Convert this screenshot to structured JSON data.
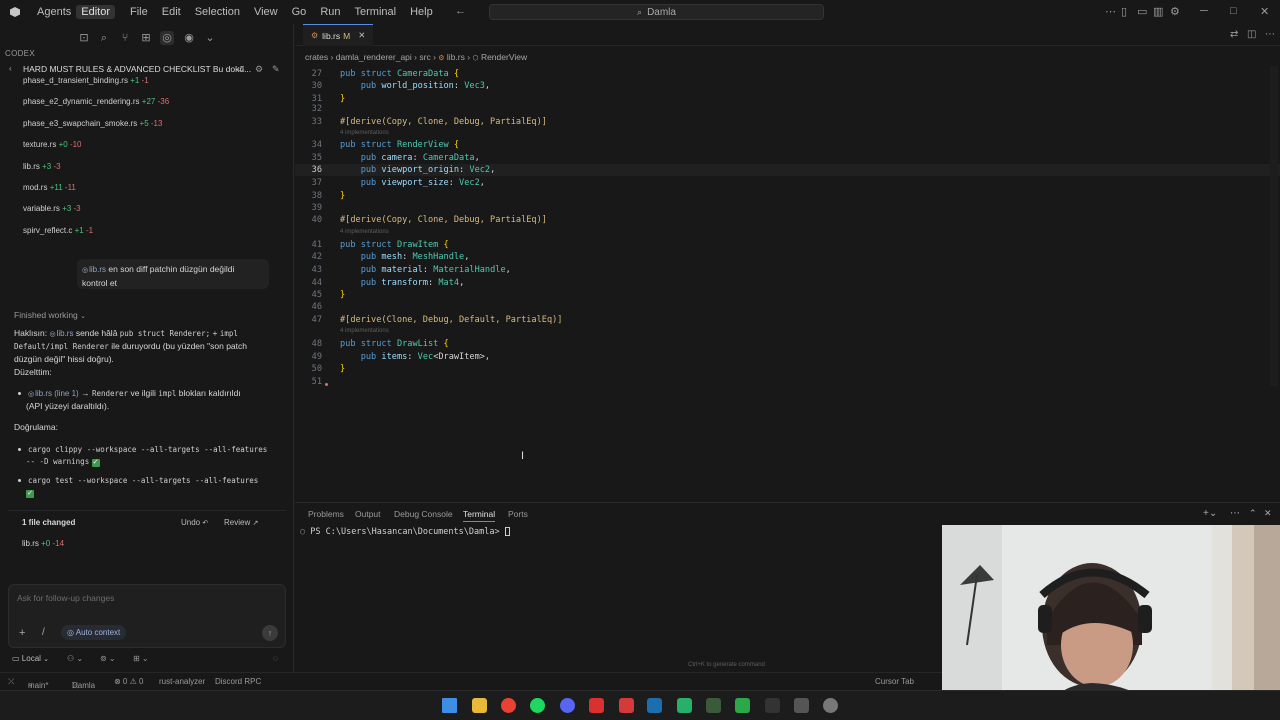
{
  "titlebar": {
    "modes": [
      "Agents",
      "Editor"
    ],
    "active_mode": "Editor",
    "menu": [
      "File",
      "Edit",
      "Selection",
      "View",
      "Go",
      "Run",
      "Terminal",
      "Help"
    ],
    "search_text": "Damla"
  },
  "codex": {
    "section_label": "CODEX",
    "chat_title": "HARD MUST RULES & ADVANCED CHECKLIST Bu dokü...",
    "changed_files": [
      {
        "name": "phase_d_transient_binding.rs",
        "plus": "+1",
        "minus": "-1"
      },
      {
        "name": "phase_e2_dynamic_rendering.rs",
        "plus": "+27",
        "minus": "-36"
      },
      {
        "name": "phase_e3_swapchain_smoke.rs",
        "plus": "+5",
        "minus": "-13"
      },
      {
        "name": "texture.rs",
        "plus": "+0",
        "minus": "-10"
      },
      {
        "name": "lib.rs",
        "plus": "+3",
        "minus": "-3"
      },
      {
        "name": "mod.rs",
        "plus": "+11",
        "minus": "-11"
      },
      {
        "name": "variable.rs",
        "plus": "+3",
        "minus": "-3"
      },
      {
        "name": "spirv_reflect.c",
        "plus": "+1",
        "minus": "-1"
      }
    ],
    "user_message": {
      "chip": "lib.rs",
      "line1": "en son diff patchin düzgün değildi",
      "line2": "kontrol et"
    },
    "status": "Finished working",
    "response": {
      "p1_a": "Haklısın:",
      "p1_chip": "lib.rs",
      "p1_b": "sende hâlâ",
      "p1_code1": "pub struct Renderer;",
      "p1_c": "+",
      "p1_code2": "impl",
      "p2_code": "Default/impl Renderer",
      "p2_text": "ile duruyordu (bu yüzden \"son patch",
      "p3": "düzgün değil\" hissi doğru).",
      "fixed_label": "Düzelttim:",
      "bullet1_chip": "lib.rs (line 1)",
      "bullet1_arrow": "→",
      "bullet1_code": "Renderer",
      "bullet1_text": "ve ilgili",
      "bullet1_code2": "impl",
      "bullet1_text2": "blokları kaldırıldı",
      "bullet1_line2": "(API yüzeyi daraltıldı).",
      "verify_label": "Doğrulama:",
      "cmd1_line1": "cargo clippy --workspace --all-targets --all-features",
      "cmd1_line2": "-- -D warnings",
      "cmd2": "cargo test --workspace --all-targets --all-features"
    },
    "summary": {
      "files_changed": "1 file changed",
      "undo": "Undo",
      "review": "Review",
      "file": "lib.rs",
      "plus": "+0",
      "minus": "-14"
    },
    "followup_placeholder": "Ask for follow-up changes",
    "auto_context": "Auto context",
    "local": "Local"
  },
  "editor": {
    "tab_name": "lib.rs",
    "tab_status": "M",
    "breadcrumb": [
      "crates",
      "damla_renderer_api",
      "src",
      "lib.rs",
      "RenderView"
    ],
    "hint": "4 implementations",
    "lines": [
      {
        "n": "27",
        "text": "pub struct CameraData {"
      },
      {
        "n": "30",
        "text": "    pub world_position: Vec3,"
      },
      {
        "n": "31",
        "text": "}"
      },
      {
        "n": "32",
        "text": ""
      },
      {
        "n": "33",
        "text": "#[derive(Copy, Clone, Debug, PartialEq)]"
      },
      {
        "n": "34",
        "text": "pub struct RenderView {"
      },
      {
        "n": "35",
        "text": "    pub camera: CameraData,"
      },
      {
        "n": "36",
        "text": "    pub viewport_origin: Vec2,"
      },
      {
        "n": "37",
        "text": "    pub viewport_size: Vec2,"
      },
      {
        "n": "38",
        "text": "}"
      },
      {
        "n": "39",
        "text": ""
      },
      {
        "n": "40",
        "text": "#[derive(Copy, Clone, Debug, PartialEq)]"
      },
      {
        "n": "41",
        "text": "pub struct DrawItem {"
      },
      {
        "n": "42",
        "text": "    pub mesh: MeshHandle,"
      },
      {
        "n": "43",
        "text": "    pub material: MaterialHandle,"
      },
      {
        "n": "44",
        "text": "    pub transform: Mat4,"
      },
      {
        "n": "45",
        "text": "}"
      },
      {
        "n": "46",
        "text": ""
      },
      {
        "n": "47",
        "text": "#[derive(Clone, Debug, Default, PartialEq)]"
      },
      {
        "n": "48",
        "text": "pub struct DrawList {"
      },
      {
        "n": "49",
        "text": "    pub items: Vec<DrawItem>,"
      },
      {
        "n": "50",
        "text": "}"
      },
      {
        "n": "51",
        "text": ""
      }
    ]
  },
  "panel": {
    "tabs": [
      "Problems",
      "Output",
      "Debug Console",
      "Terminal",
      "Ports"
    ],
    "active_tab": "Terminal",
    "terminal_prompt": "PS C:\\Users\\Hasancan\\Documents\\Damla> ",
    "generate_hint": "Ctrl+K to generate command"
  },
  "statusbar": {
    "branch": "main*",
    "project": "Damla",
    "problems": "⊗ 0 ⚠ 0",
    "rust_analyzer": "rust-analyzer",
    "discord": "Discord RPC",
    "cursor_tab": "Cursor Tab"
  },
  "colors": {
    "accent": "#5a8be0",
    "added": "#4ec27a",
    "removed": "#e06c6c",
    "background": "#181818"
  },
  "taskbar_icons": [
    "windows-start-icon",
    "file-explorer-icon",
    "chrome-icon",
    "spotify-icon",
    "discord-icon",
    "app-red-icon",
    "app-game-icon",
    "steam-icon",
    "app-green-icon",
    "app-tank-icon",
    "app-green2-icon",
    "wondershare-icon",
    "cursor-icon",
    "obs-icon"
  ]
}
